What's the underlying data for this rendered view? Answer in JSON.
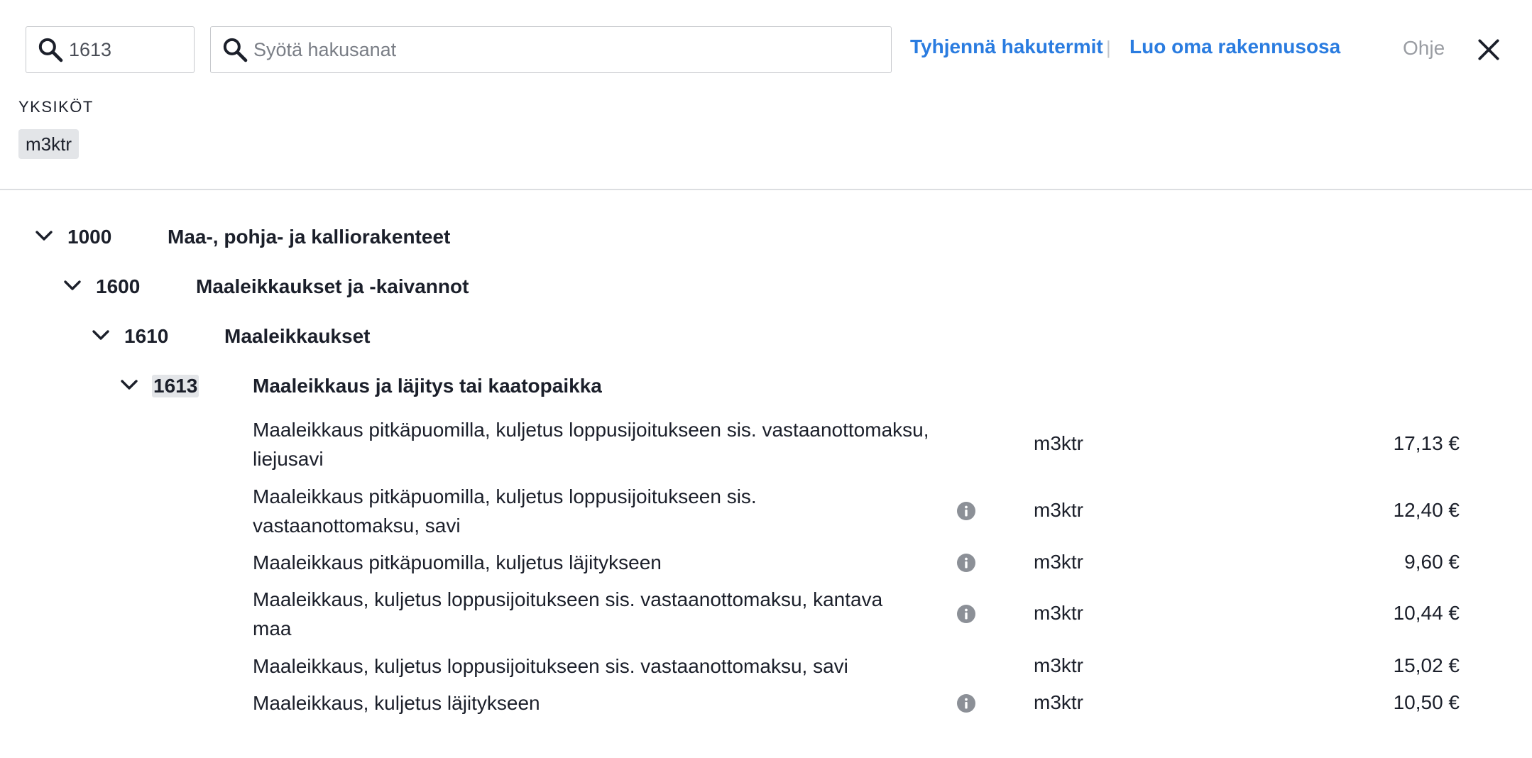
{
  "search": {
    "code_value": "1613",
    "keywords_placeholder": "Syötä hakusanat",
    "clear_label": "Tyhjennä hakutermit",
    "separator": "|",
    "create_label": "Luo oma rakennusosa",
    "help_label": "Ohje"
  },
  "units": {
    "label": "YKSIKÖT",
    "chip": "m3ktr"
  },
  "tree": [
    {
      "code": "1000",
      "name": "Maa-, pohja- ja kalliorakenteet"
    },
    {
      "code": "1600",
      "name": "Maaleikkaukset ja -kaivannot"
    },
    {
      "code": "1610",
      "name": "Maaleikkaukset"
    },
    {
      "code": "1613",
      "name": "Maaleikkaus ja läjitys tai kaatopaikka"
    }
  ],
  "items": [
    {
      "desc_1": "Maaleikkaus pitkäpuomilla, kuljetus loppusijoitukseen sis. vastaanottomaksu,",
      "desc_2": "liejusavi",
      "unit": "m3ktr",
      "price": "17,13 €",
      "info": false
    },
    {
      "desc_1": "Maaleikkaus pitkäpuomilla, kuljetus loppusijoitukseen sis.",
      "desc_2": "vastaanottomaksu, savi",
      "unit": "m3ktr",
      "price": "12,40 €",
      "info": true
    },
    {
      "desc_1": "Maaleikkaus pitkäpuomilla, kuljetus läjitykseen",
      "desc_2": "",
      "unit": "m3ktr",
      "price": "9,60 €",
      "info": true
    },
    {
      "desc_1": "Maaleikkaus, kuljetus loppusijoitukseen sis. vastaanottomaksu, kantava",
      "desc_2": "maa",
      "unit": "m3ktr",
      "price": "10,44 €",
      "info": true
    },
    {
      "desc_1": "Maaleikkaus, kuljetus loppusijoitukseen sis. vastaanottomaksu, savi",
      "desc_2": "",
      "unit": "m3ktr",
      "price": "15,02 €",
      "info": false
    },
    {
      "desc_1": "Maaleikkaus, kuljetus läjitykseen",
      "desc_2": "",
      "unit": "m3ktr",
      "price": "10,50 €",
      "info": true
    }
  ],
  "icons": {
    "search": "search-icon",
    "close": "close-icon",
    "chevron": "chevron-down-icon",
    "info": "info-icon"
  },
  "colors": {
    "link": "#2a7ce0",
    "chip_bg": "#e3e5e8",
    "info_icon": "#8c9097"
  }
}
